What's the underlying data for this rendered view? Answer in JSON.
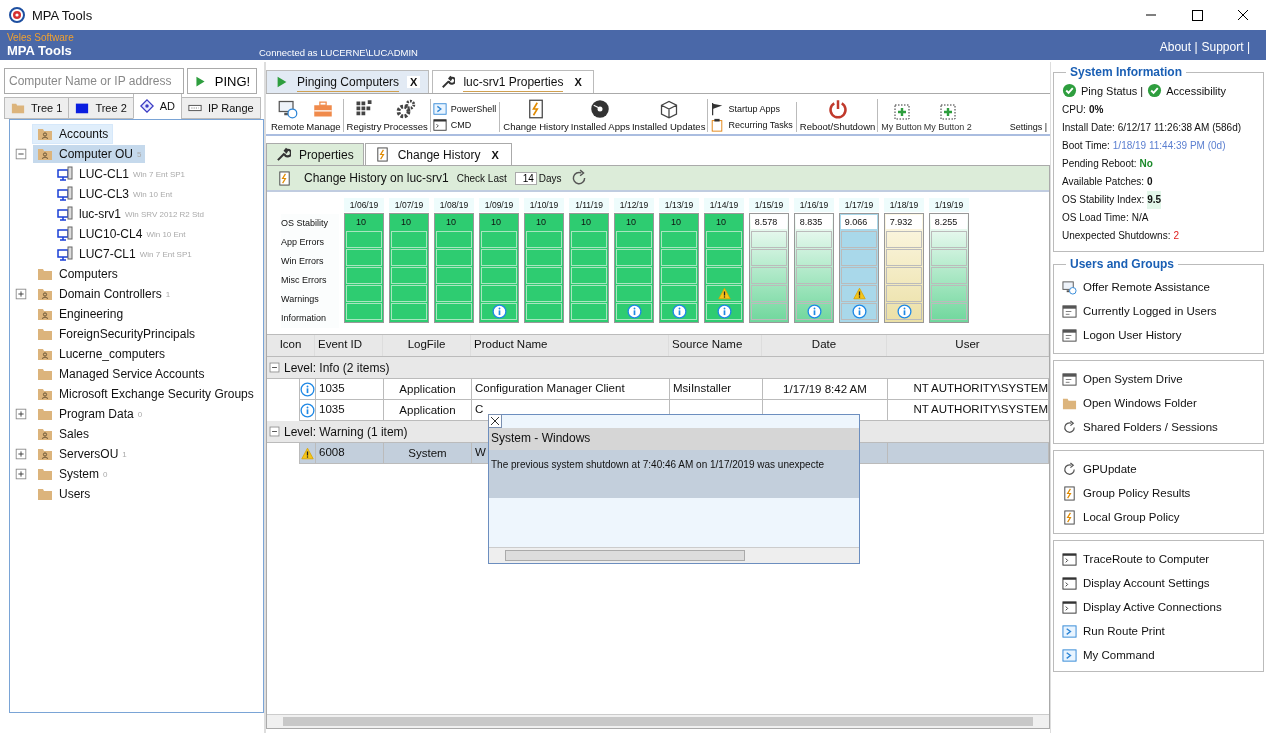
{
  "window": {
    "title": "MPA Tools"
  },
  "header": {
    "vendor": "Veles Software",
    "product": "MPA Tools",
    "connection": "Connected as LUCERNE\\LUCADMIN",
    "links": [
      "About |",
      "Support |"
    ]
  },
  "lookup": {
    "placeholder": "Computer Name or IP address",
    "button": "PING!"
  },
  "left_tabs": [
    {
      "label": "Tree 1",
      "selected": false
    },
    {
      "label": "Tree 2",
      "selected": false
    },
    {
      "label": "AD",
      "selected": true
    },
    {
      "label": "IP Range",
      "selected": false
    }
  ],
  "tree": [
    {
      "label": "Accounts",
      "kind": "ou",
      "selected": false,
      "hover": true
    },
    {
      "label": "Computer OU",
      "kind": "ou",
      "count": "5",
      "expanded": true,
      "selected": true,
      "hover": false,
      "children": [
        {
          "label": "LUC-CL1",
          "os": "Win 7 Ent SP1"
        },
        {
          "label": "LUC-CL3",
          "os": "Win 10 Ent"
        },
        {
          "label": "luc-srv1",
          "os": "Win SRV 2012 R2 Std"
        },
        {
          "label": "LUC10-CL4",
          "os": "Win 10 Ent"
        },
        {
          "label": "LUC7-CL1",
          "os": "Win 7 Ent SP1"
        }
      ]
    },
    {
      "label": "Computers",
      "kind": "folder",
      "selected": false,
      "hover": false
    },
    {
      "label": "Domain Controllers",
      "kind": "ou",
      "count": "1",
      "expanded": false,
      "selected": false,
      "hover": false
    },
    {
      "label": "Engineering",
      "kind": "ou",
      "selected": false,
      "hover": false
    },
    {
      "label": "ForeignSecurityPrincipals",
      "kind": "folder",
      "selected": false,
      "hover": false
    },
    {
      "label": "Lucerne_computers",
      "kind": "ou",
      "selected": false,
      "hover": false
    },
    {
      "label": "Managed Service Accounts",
      "kind": "folder",
      "selected": false,
      "hover": false
    },
    {
      "label": "Microsoft Exchange Security Groups",
      "kind": "ou",
      "selected": false,
      "hover": false
    },
    {
      "label": "Program Data",
      "kind": "folder",
      "count": "0",
      "expanded": false,
      "selected": false,
      "hover": false
    },
    {
      "label": "Sales",
      "kind": "ou",
      "selected": false,
      "hover": false
    },
    {
      "label": "ServersOU",
      "kind": "ou",
      "count": "1",
      "expanded": false,
      "selected": false,
      "hover": false
    },
    {
      "label": "System",
      "kind": "folder",
      "count": "0",
      "expanded": false,
      "selected": false,
      "hover": false
    },
    {
      "label": "Users",
      "kind": "folder",
      "selected": false,
      "hover": false
    }
  ],
  "tabs": [
    {
      "label": "Pinging Computers",
      "close": "X",
      "selected": false
    },
    {
      "label": "luc-srv1 Properties",
      "close": "X",
      "selected": true
    }
  ],
  "toolbar": {
    "groups": [
      {
        "kind": "large",
        "items": [
          "Remote",
          "Manage"
        ]
      },
      {
        "kind": "large",
        "items": [
          "Registry",
          "Processes"
        ]
      },
      {
        "kind": "small",
        "items": [
          "PowerShell",
          "CMD"
        ]
      },
      {
        "kind": "large",
        "items": [
          "Change History",
          "Installed Apps",
          "Installed Updates"
        ]
      },
      {
        "kind": "small",
        "items": [
          "Startup Apps",
          "Recurring Tasks"
        ]
      },
      {
        "kind": "large",
        "items": [
          "Reboot/Shutdown"
        ]
      },
      {
        "kind": "custom",
        "items": [
          "My Button",
          "My Button 2"
        ]
      }
    ],
    "settings": "Settings |"
  },
  "sub_tabs": [
    {
      "label": "Properties",
      "selected": false
    },
    {
      "label": "Change History",
      "close": "X",
      "selected": true
    }
  ],
  "history": {
    "title": "Change History on luc-srv1",
    "check_label": "Check Last",
    "check_value": "14",
    "check_unit": "Days",
    "rows": [
      "OS Stability",
      "App Errors",
      "Win Errors",
      "Misc Errors",
      "Warnings",
      "Information"
    ],
    "days": [
      {
        "date": "1/06/19",
        "score": "10",
        "kind": "solid",
        "selected": false,
        "today": false,
        "warning": false,
        "info": false
      },
      {
        "date": "1/07/19",
        "score": "10",
        "kind": "solid",
        "selected": false,
        "today": false,
        "warning": false,
        "info": false
      },
      {
        "date": "1/08/19",
        "score": "10",
        "kind": "solid",
        "selected": false,
        "today": false,
        "warning": false,
        "info": false
      },
      {
        "date": "1/09/19",
        "score": "10",
        "kind": "solid",
        "selected": false,
        "today": false,
        "warning": false,
        "info": true
      },
      {
        "date": "1/10/19",
        "score": "10",
        "kind": "solid",
        "selected": false,
        "today": false,
        "warning": false,
        "info": false
      },
      {
        "date": "1/11/19",
        "score": "10",
        "kind": "solid",
        "selected": false,
        "today": false,
        "warning": false,
        "info": false
      },
      {
        "date": "1/12/19",
        "score": "10",
        "kind": "solid",
        "selected": false,
        "today": false,
        "warning": false,
        "info": true
      },
      {
        "date": "1/13/19",
        "score": "10",
        "kind": "solid",
        "selected": false,
        "today": false,
        "warning": false,
        "info": true
      },
      {
        "date": "1/14/19",
        "score": "10",
        "kind": "solid",
        "selected": false,
        "today": false,
        "warning": true,
        "info": true
      },
      {
        "date": "1/15/19",
        "score": "8.578",
        "kind": "gradient",
        "selected": false,
        "today": false,
        "warning": false,
        "info": false
      },
      {
        "date": "1/16/19",
        "score": "8.835",
        "kind": "gradient",
        "selected": false,
        "today": false,
        "warning": false,
        "info": true
      },
      {
        "date": "1/17/19",
        "score": "9.066",
        "kind": "gradient",
        "selected": true,
        "today": false,
        "warning": true,
        "info": true
      },
      {
        "date": "1/18/19",
        "score": "7.932",
        "kind": "gradient",
        "selected": false,
        "today": true,
        "warning": false,
        "info": true
      },
      {
        "date": "1/19/19",
        "score": "8.255",
        "kind": "gradient",
        "selected": false,
        "today": false,
        "warning": false,
        "info": false
      }
    ]
  },
  "table": {
    "columns": [
      "Icon",
      "Event ID",
      "LogFile",
      "Product Name",
      "Source Name",
      "Date",
      "User"
    ],
    "groups": [
      {
        "label": "Level: Info (2 items)",
        "expanded": true,
        "rows": [
          {
            "kind": "info",
            "event_id": "1035",
            "logfile": "Application",
            "product": "Configuration Manager Client",
            "source": "MsiInstaller",
            "date": "1/17/19 8:42 AM",
            "user": "NT AUTHORITY\\SYSTEM",
            "selected": false
          },
          {
            "kind": "info",
            "event_id": "1035",
            "logfile": "Application",
            "product": "C",
            "user": "NT AUTHORITY\\SYSTEM",
            "selected": false
          }
        ]
      },
      {
        "label": "Level: Warning (1 item)",
        "expanded": true,
        "rows": [
          {
            "kind": "warning",
            "event_id": "6008",
            "logfile": "System",
            "product": "W",
            "selected": true
          }
        ]
      }
    ]
  },
  "popup": {
    "title": "System - Windows",
    "message": "The previous system shutdown at 7:40:46 AM on 1/17/2019 was unexpecte"
  },
  "system_info": {
    "title": "System Information",
    "status": [
      "Ping Status |",
      "Accessibility"
    ],
    "items": [
      {
        "label": "CPU:",
        "value": "0%",
        "kind": "bold"
      },
      {
        "label": "Install Date:",
        "value": "6/12/17 11:26:38 AM (586d)",
        "kind": "plain"
      },
      {
        "label": "Boot Time:",
        "value": "1/18/19 11:44:39 PM (0d)",
        "kind": "link"
      },
      {
        "label": "Pending Reboot:",
        "value": "No",
        "kind": "good"
      },
      {
        "label": "Available Patches:",
        "value": "0",
        "kind": "bold"
      },
      {
        "label": "OS Stability Index:",
        "value": "9.5",
        "kind": "highlight"
      },
      {
        "label": "OS Load Time:",
        "value": "N/A",
        "kind": "plain"
      },
      {
        "label": "Unexpected Shutdowns:",
        "value": "2",
        "kind": "bad"
      }
    ]
  },
  "action_groups": [
    {
      "title": "Users and Groups",
      "items": [
        "Offer Remote Assistance",
        "Currently Logged in Users",
        "Logon User History"
      ]
    },
    {
      "items": [
        "Open System Drive",
        "Open Windows Folder",
        "Shared Folders / Sessions"
      ]
    },
    {
      "items": [
        "GPUpdate",
        "Group Policy Results",
        "Local Group Policy"
      ]
    },
    {
      "items": [
        "TraceRoute to Computer",
        "Display Account Settings",
        "Display Active Connections",
        "Run Route Print",
        "My Command"
      ]
    }
  ]
}
